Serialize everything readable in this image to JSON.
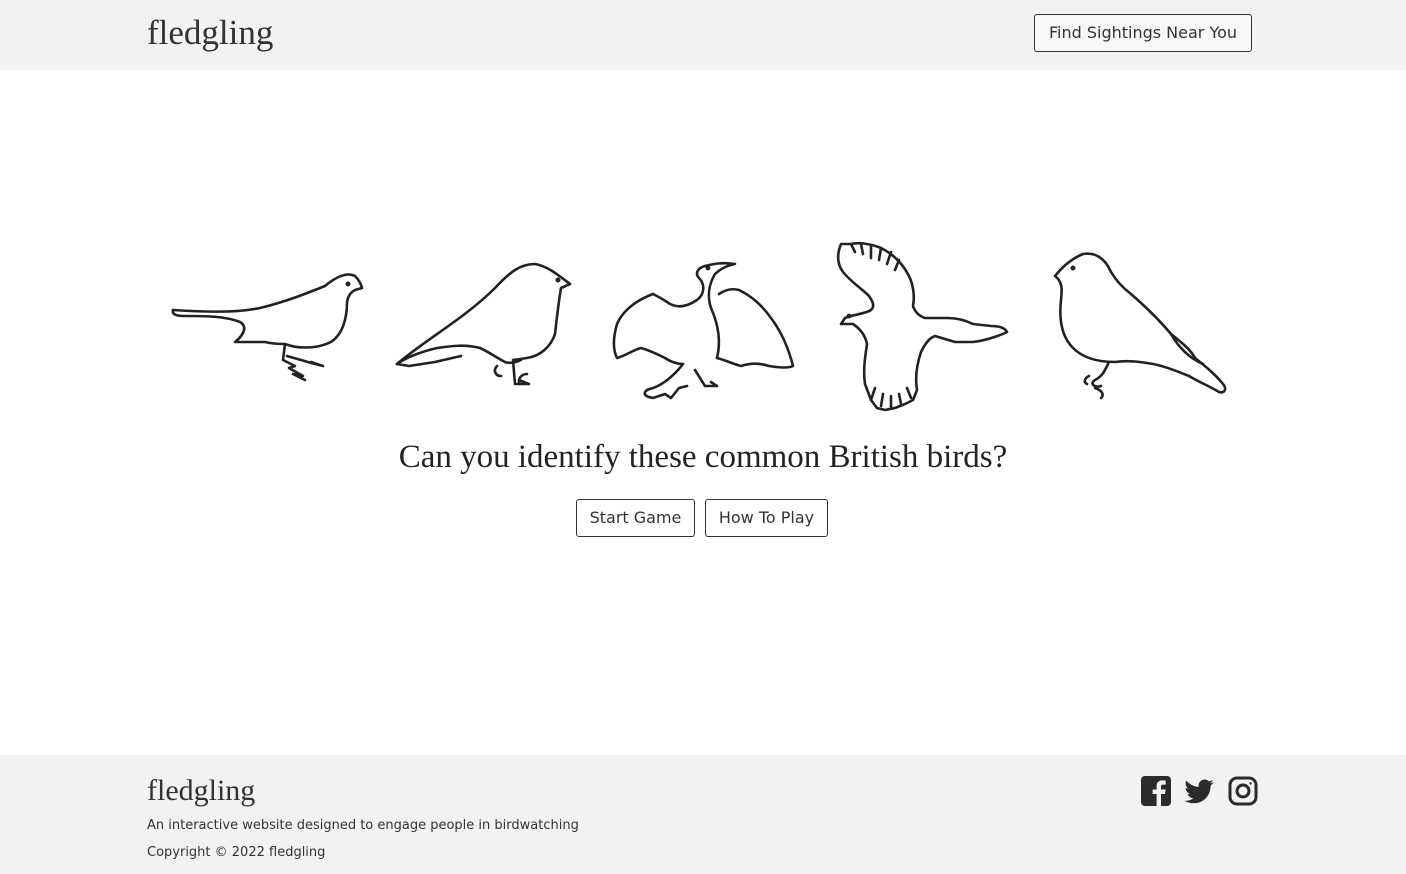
{
  "header": {
    "brand": "fledgling",
    "find_sightings_label": "Find Sightings Near You"
  },
  "hero": {
    "headline": "Can you identify these common British birds?",
    "birds": [
      "bird-silhouette-1",
      "bird-silhouette-2",
      "bird-silhouette-3",
      "bird-silhouette-4",
      "bird-silhouette-5"
    ],
    "start_game_label": "Start Game",
    "how_to_play_label": "How To Play"
  },
  "footer": {
    "brand": "fledgling",
    "tagline": "An interactive website designed to engage people in birdwatching",
    "copyright": "Copyright © 2022 fledgling",
    "social": [
      "facebook-icon",
      "twitter-icon",
      "instagram-icon"
    ]
  },
  "colors": {
    "band_background": "#f2f2f2",
    "text": "#333333",
    "page_background": "#ffffff"
  }
}
